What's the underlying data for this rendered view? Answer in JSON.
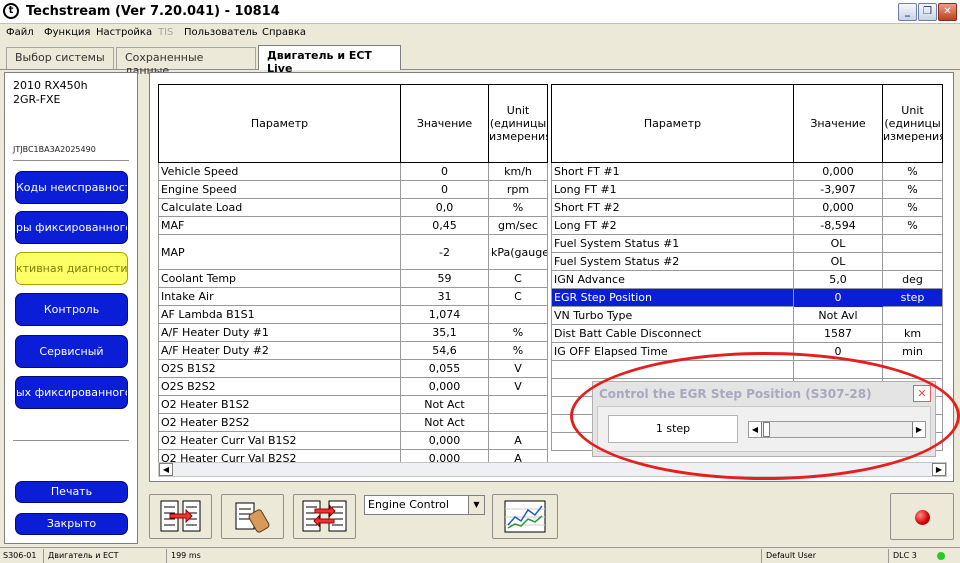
{
  "window": {
    "title": "Techstream (Ver 7.20.041) - 10814"
  },
  "menu": [
    {
      "label": "Файл",
      "disabled": false
    },
    {
      "label": "Функция",
      "disabled": false
    },
    {
      "label": "Настройка",
      "disabled": false
    },
    {
      "label": "TIS",
      "disabled": true
    },
    {
      "label": "Пользователь",
      "disabled": false
    },
    {
      "label": "Справка",
      "disabled": false
    }
  ],
  "tabs": [
    {
      "label": "Выбор системы",
      "active": false
    },
    {
      "label": "Сохраненные данные",
      "active": false
    },
    {
      "label": "Двигатель и ECT Live",
      "active": true
    }
  ],
  "vehicle": {
    "model": "2010 RX450h",
    "engine": "2GR-FXE",
    "vin": "JTJBC1BA3A2025490"
  },
  "nav_buttons": [
    {
      "label": "Коды неисправности"
    },
    {
      "label": "ры фиксированного"
    },
    {
      "label": "ктивная диагностик",
      "disabled": true
    },
    {
      "label": "Контроль"
    },
    {
      "label": "Сервисный"
    },
    {
      "label": "ых фиксированного"
    }
  ],
  "footer_buttons": {
    "print": "Печать",
    "close": "Закрыто"
  },
  "table_headers": {
    "param": "Параметр",
    "value": "Значение",
    "unit": "Unit (единицы измерения)"
  },
  "left_rows": [
    {
      "param": "Vehicle Speed",
      "value": "0",
      "unit": "km/h"
    },
    {
      "param": "Engine Speed",
      "value": "0",
      "unit": "rpm"
    },
    {
      "param": "Calculate Load",
      "value": "0,0",
      "unit": "%"
    },
    {
      "param": "MAF",
      "value": "0,45",
      "unit": "gm/sec"
    },
    {
      "param": "MAP",
      "value": "-2",
      "unit": "kPa(gauge)",
      "tall": true
    },
    {
      "param": "Coolant Temp",
      "value": "59",
      "unit": "C"
    },
    {
      "param": "Intake Air",
      "value": "31",
      "unit": "C"
    },
    {
      "param": "AF Lambda B1S1",
      "value": "1,074",
      "unit": ""
    },
    {
      "param": "A/F Heater Duty #1",
      "value": "35,1",
      "unit": "%"
    },
    {
      "param": "A/F Heater Duty #2",
      "value": "54,6",
      "unit": "%"
    },
    {
      "param": "O2S B1S2",
      "value": "0,055",
      "unit": "V"
    },
    {
      "param": "O2S B2S2",
      "value": "0,000",
      "unit": "V"
    },
    {
      "param": "O2 Heater B1S2",
      "value": "Not Act",
      "unit": ""
    },
    {
      "param": "O2 Heater B2S2",
      "value": "Not Act",
      "unit": ""
    },
    {
      "param": "O2 Heater Curr Val B1S2",
      "value": "0,000",
      "unit": "A"
    },
    {
      "param": "O2 Heater Curr Val B2S2",
      "value": "0,000",
      "unit": "A"
    }
  ],
  "right_rows": [
    {
      "param": "Short FT #1",
      "value": "0,000",
      "unit": "%"
    },
    {
      "param": "Long FT #1",
      "value": "-3,907",
      "unit": "%"
    },
    {
      "param": "Short FT #2",
      "value": "0,000",
      "unit": "%"
    },
    {
      "param": "Long FT #2",
      "value": "-8,594",
      "unit": "%"
    },
    {
      "param": "Fuel System Status #1",
      "value": "OL",
      "unit": ""
    },
    {
      "param": "Fuel System Status #2",
      "value": "OL",
      "unit": ""
    },
    {
      "param": "IGN Advance",
      "value": "5,0",
      "unit": "deg"
    },
    {
      "param": "EGR Step Position",
      "value": "0",
      "unit": "step",
      "selected": true
    },
    {
      "param": "VN Turbo Type",
      "value": "Not Avl",
      "unit": ""
    },
    {
      "param": "Dist Batt Cable Disconnect",
      "value": "1587",
      "unit": "km"
    },
    {
      "param": "IG OFF Elapsed Time",
      "value": "0",
      "unit": "min"
    },
    {
      "param": "",
      "value": "",
      "unit": ""
    },
    {
      "param": "",
      "value": "",
      "unit": ""
    },
    {
      "param": "",
      "value": "",
      "unit": ""
    },
    {
      "param": "",
      "value": "",
      "unit": ""
    },
    {
      "param": "",
      "value": "",
      "unit": ""
    }
  ],
  "dialog": {
    "title": "Control the EGR Step Position (S307-28)",
    "value": "1 step",
    "slider_fraction": 0.0
  },
  "toolbar": {
    "select_value": "Engine Control"
  },
  "status": {
    "code": "S306-01",
    "system": "Двигатель и ECT",
    "interval": "199 ms",
    "user": "Default User",
    "dlc": "DLC 3"
  },
  "colors": {
    "highlight": "#0a1ed8",
    "button": "#0a1ed8",
    "disabled_button": "#ffff66",
    "annotation": "#e61e1e",
    "dlc_ok": "#22cc22"
  }
}
